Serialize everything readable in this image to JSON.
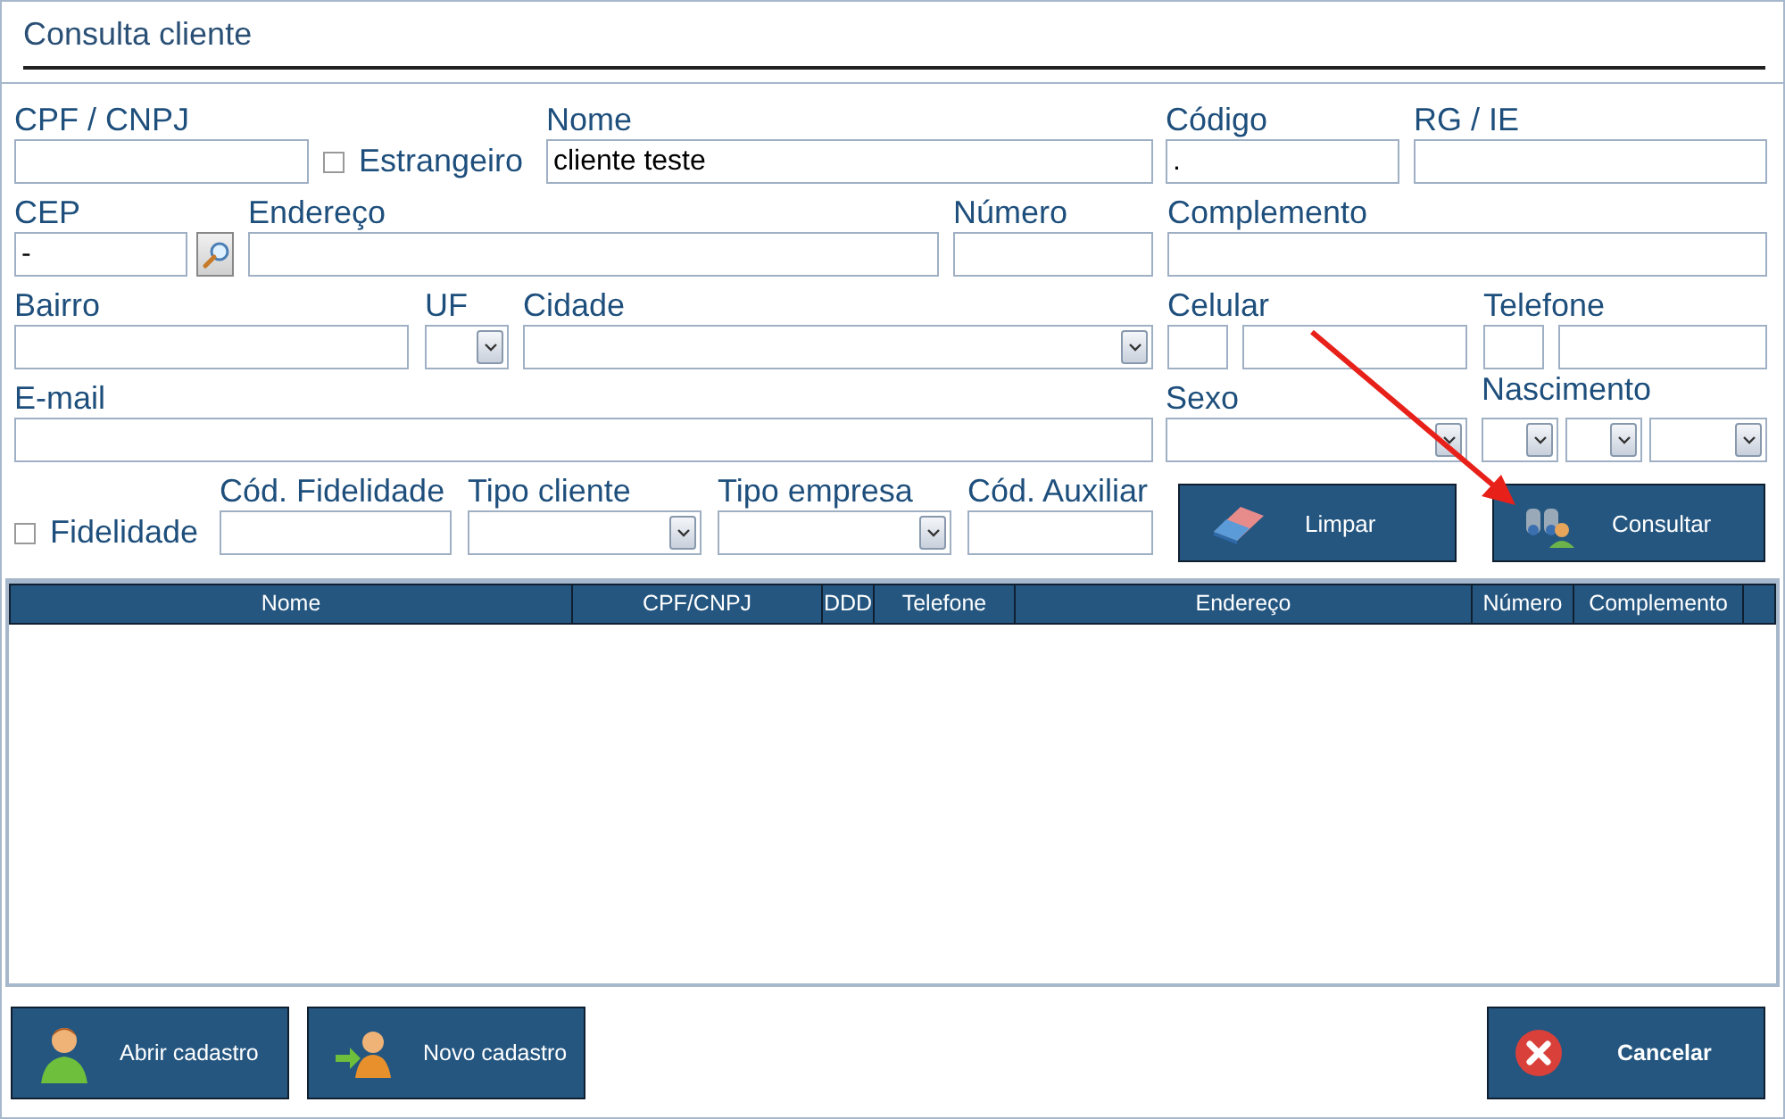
{
  "window": {
    "title": "Consulta cliente"
  },
  "form": {
    "rows": [
      {
        "fields": [
          {
            "kind": "text",
            "label": "CPF / CNPJ"
          },
          {
            "kind": "checkbox",
            "label": "Estrangeiro",
            "checked": false
          },
          {
            "kind": "text",
            "label": "Nome",
            "value": "cliente teste"
          },
          {
            "kind": "text",
            "label": "Código",
            "value": "."
          },
          {
            "kind": "text",
            "label": "RG / IE"
          }
        ]
      },
      {
        "fields": [
          {
            "kind": "text",
            "label": "CEP",
            "value": "-"
          },
          {
            "kind": "search"
          },
          {
            "kind": "text",
            "label": "Endereço"
          },
          {
            "kind": "text",
            "label": "Número"
          },
          {
            "kind": "text",
            "label": "Complemento"
          }
        ]
      },
      {
        "fields": [
          {
            "kind": "text",
            "label": "Bairro"
          },
          {
            "kind": "select",
            "label": "UF"
          },
          {
            "kind": "select",
            "label": "Cidade"
          },
          {
            "kind": "phone",
            "label": "Celular"
          },
          {
            "kind": "phone",
            "label": "Telefone"
          }
        ]
      },
      {
        "fields": [
          {
            "kind": "text",
            "label": "E-mail"
          },
          {
            "kind": "select",
            "label": "Sexo"
          },
          {
            "kind": "date",
            "label": "Nascimento"
          }
        ]
      },
      {
        "fields": [
          {
            "kind": "checkbox",
            "label": "Fidelidade",
            "checked": false
          },
          {
            "kind": "text",
            "label": "Cód. Fidelidade"
          },
          {
            "kind": "select",
            "label": "Tipo cliente"
          },
          {
            "kind": "select",
            "label": "Tipo empresa"
          },
          {
            "kind": "text",
            "label": "Cód. Auxiliar"
          },
          {
            "kind": "button",
            "label": "Limpar"
          },
          {
            "kind": "button",
            "label": "Consultar"
          }
        ]
      }
    ]
  },
  "table": {
    "columns": [
      "Nome",
      "CPF/CNPJ",
      "DDD",
      "Telefone",
      "Endereço",
      "Número",
      "Complemento"
    ]
  },
  "footer": {
    "buttons": [
      {
        "label": "Abrir cadastro",
        "emphasized": false
      },
      {
        "label": "Novo cadastro",
        "emphasized": false
      },
      {
        "label": "Cancelar",
        "emphasized": true
      }
    ]
  }
}
